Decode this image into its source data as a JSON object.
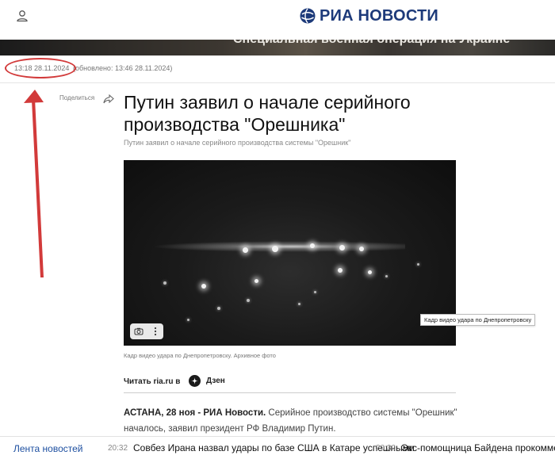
{
  "header": {
    "logo_text": "РИА НОВОСТИ",
    "brand_color": "#1d3a7a",
    "user_icon": "user-icon"
  },
  "banner": {
    "text": "Специальная военная операция на Украине"
  },
  "article": {
    "published": "13:18 28.11.2024",
    "updated": "(обновлено: 13:46 28.11.2024)",
    "share_label": "Поделиться",
    "title": "Путин заявил о начале серийного производства \"Орешника\"",
    "subtitle": "Путин заявил о начале серийного производства системы \"Орешник\"",
    "image_tooltip": "Кадр видео удара по Днепропетровску",
    "image_caption": "Кадр видео удара по Днепропетровску. Архивное фото",
    "read_label": "Читать ria.ru в",
    "dzen_label": "Дзен",
    "lead_strong": "АСТАНА, 28 ноя - РИА Новости.",
    "lead_text": " Серийное производство системы \"Орешник\" началось, заявил президент РФ Владимир Путин."
  },
  "annotation": {
    "color": "#d23a3a"
  },
  "bottom_bar": {
    "feed_label": "Лента новостей",
    "items": [
      {
        "time": "20:32",
        "title": "Совбез Ирана назвал удары по базе США в Катаре успешными"
      },
      {
        "time": "20:30",
        "title": "Экс-помощница Байдена прокомментировала заявление Каролайн"
      }
    ]
  }
}
